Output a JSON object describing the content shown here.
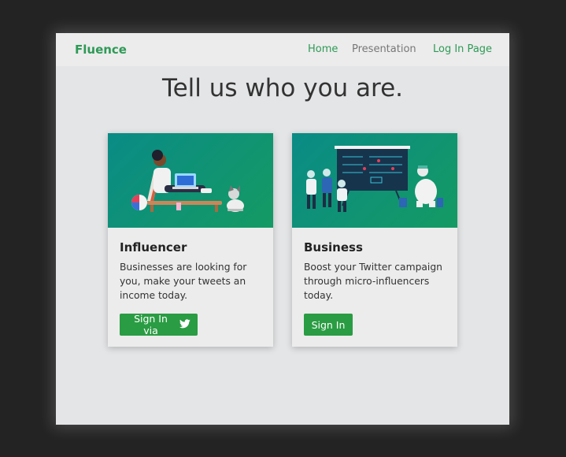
{
  "nav": {
    "brand": "Fluence",
    "links": [
      "Home",
      "Presentation",
      "Log In Page"
    ]
  },
  "headline": "Tell us who you are.",
  "cards": [
    {
      "title": "Influencer",
      "text": "Businesses are looking for you, make your tweets an income today.",
      "button_label": "Sign In via",
      "button_icon": "twitter-icon"
    },
    {
      "title": "Business",
      "text": "Boost your Twitter campaign through micro-influencers today.",
      "button_label": "Sign In"
    }
  ],
  "colors": {
    "brand": "#2e9a57",
    "button": "#2a9c43",
    "card_image_gradient": [
      "#0a8b86",
      "#149a63"
    ]
  }
}
